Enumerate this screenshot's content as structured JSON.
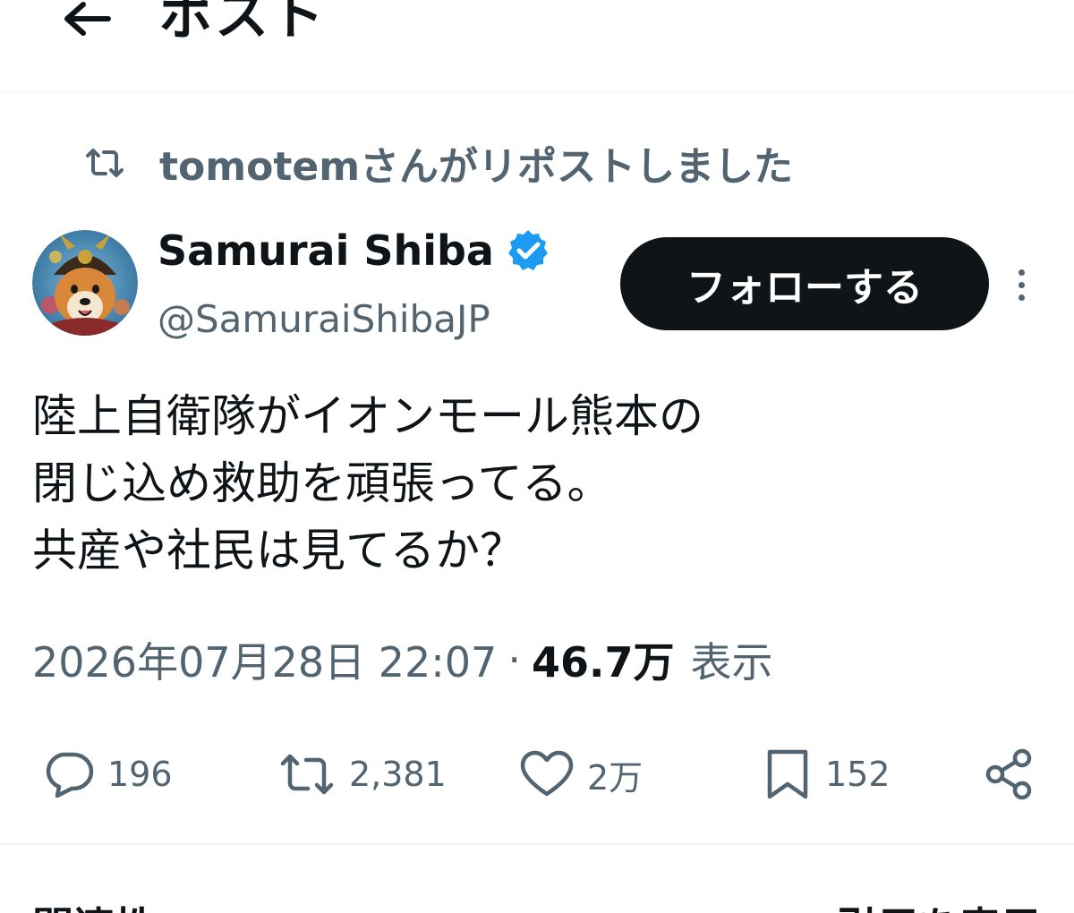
{
  "header": {
    "title": "ポスト",
    "back_icon": "arrow-left-icon"
  },
  "repost": {
    "icon": "repost-icon",
    "text": "tomotemさんがリポストしました"
  },
  "author": {
    "display_name": "Samurai Shiba",
    "handle": "@SamuraiShibaJP",
    "verified": true,
    "verified_color": "#1d9bf0",
    "avatar": "samurai-shiba-avatar"
  },
  "follow_button": {
    "label": "フォローする"
  },
  "tweet": {
    "lines": [
      "陸上自衛隊がイオンモール熊本の",
      "閉じ込め救助を頑張ってる。",
      "共産や社民は見てるか？"
    ]
  },
  "meta": {
    "timestamp": "2026年07月28日 22:07",
    "separator": "·",
    "views_count": "46.7万",
    "views_label": "表示"
  },
  "actions": {
    "replies": "196",
    "reposts": "2,381",
    "likes": "2万",
    "bookmarks": "152"
  },
  "colors": {
    "text": "#0f1419",
    "secondary": "#536471",
    "accent": "#1d9bf0",
    "button_bg": "#0f1419"
  },
  "footer": {
    "related_title": "関連性",
    "show_quotes": "引用を表示"
  }
}
